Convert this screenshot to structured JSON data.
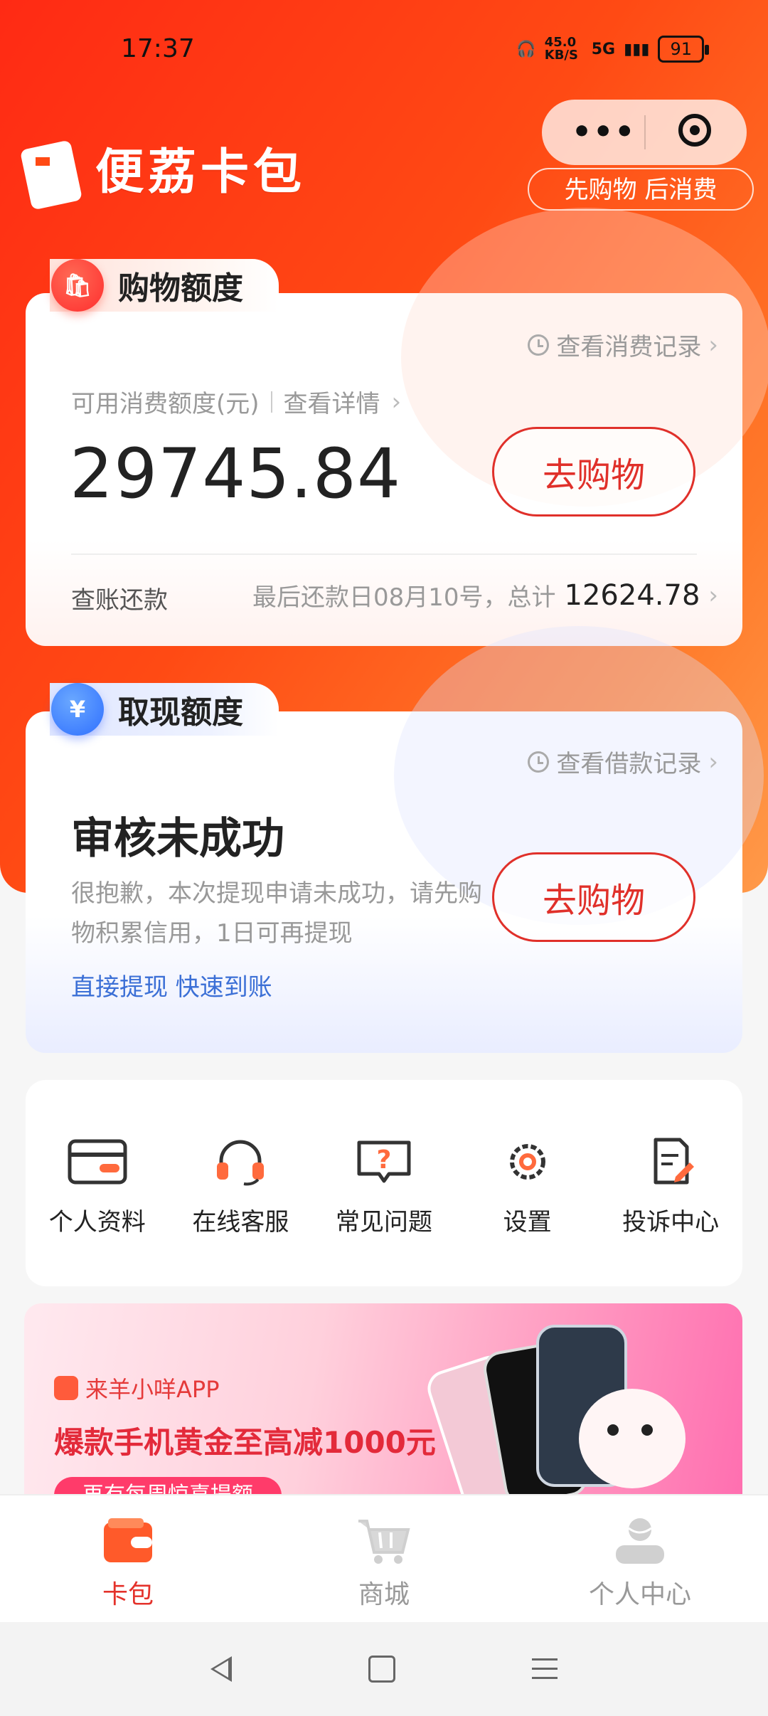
{
  "status": {
    "time": "17:37",
    "speed": "45.0 KB/S",
    "network": "5G",
    "battery": "91"
  },
  "app": {
    "name": "便荔卡包",
    "slogan": "先购物 后消费"
  },
  "shopping": {
    "tab_label": "购物额度",
    "record_link": "查看消费记录",
    "avail_label": "可用消费额度(元)",
    "detail_link": "查看详情",
    "amount": "29745.84",
    "button": "去购物",
    "repay_label": "查账还款",
    "repay_info": "最后还款日08月10号，总计",
    "repay_total": "12624.78"
  },
  "cash": {
    "tab_label": "取现额度",
    "record_link": "查看借款记录",
    "title": "审核未成功",
    "desc": "很抱歉，本次提现申请未成功，请先购物积累信用，1日可再提现",
    "link": "直接提现 快速到账",
    "button": "去购物"
  },
  "menu": [
    {
      "label": "个人资料",
      "icon": "id-card-icon"
    },
    {
      "label": "在线客服",
      "icon": "headset-icon"
    },
    {
      "label": "常见问题",
      "icon": "question-icon"
    },
    {
      "label": "设置",
      "icon": "gear-icon"
    },
    {
      "label": "投诉中心",
      "icon": "complaint-doc-icon"
    }
  ],
  "banner": {
    "brand": "来羊小咩APP",
    "headline": "爆款手机黄金至高减1000元",
    "pill": "再有每周惊喜提额"
  },
  "tabs": [
    {
      "label": "卡包",
      "icon": "wallet-icon",
      "active": true
    },
    {
      "label": "商城",
      "icon": "cart-icon",
      "active": false
    },
    {
      "label": "个人中心",
      "icon": "user-icon",
      "active": false
    }
  ],
  "colors": {
    "accent": "#e4322b",
    "hero_start": "#ff2a14",
    "hero_end": "#ff9a4a",
    "link_blue": "#3b6fd6"
  }
}
